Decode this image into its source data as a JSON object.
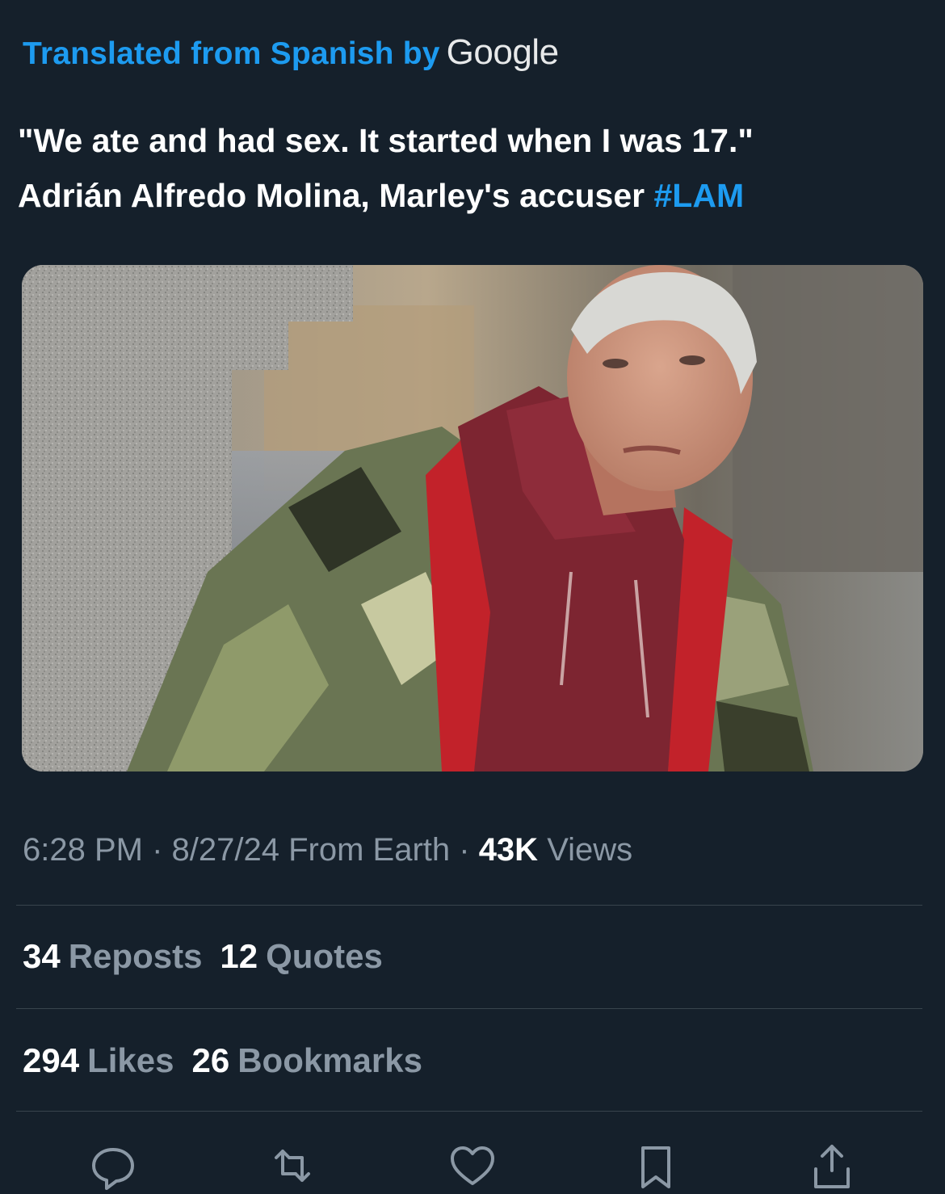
{
  "translation": {
    "prefix": "Translated from Spanish by",
    "provider": "Google"
  },
  "tweet": {
    "line1": "\"We ate and had sex. It started when I was 17.\"",
    "line2": "Adrián Alfredo Molina, Marley's accuser",
    "hashtag": "#LAM"
  },
  "meta": {
    "time": "6:28 PM",
    "sep1": " · ",
    "date": "8/27/24",
    "source": " From Earth",
    "sep2": " · ",
    "views_count": "43K",
    "views_label": "Views"
  },
  "stats": {
    "reposts_count": "34",
    "reposts_label": "Reposts",
    "quotes_count": "12",
    "quotes_label": "Quotes",
    "likes_count": "294",
    "likes_label": "Likes",
    "bookmarks_count": "26",
    "bookmarks_label": "Bookmarks"
  },
  "actions": [
    "reply-icon",
    "repost-icon",
    "like-icon",
    "bookmark-icon",
    "share-icon"
  ],
  "colors": {
    "background": "#15202b",
    "accent": "#1d9bf0",
    "muted": "#8b98a5",
    "divider": "#38444d"
  }
}
